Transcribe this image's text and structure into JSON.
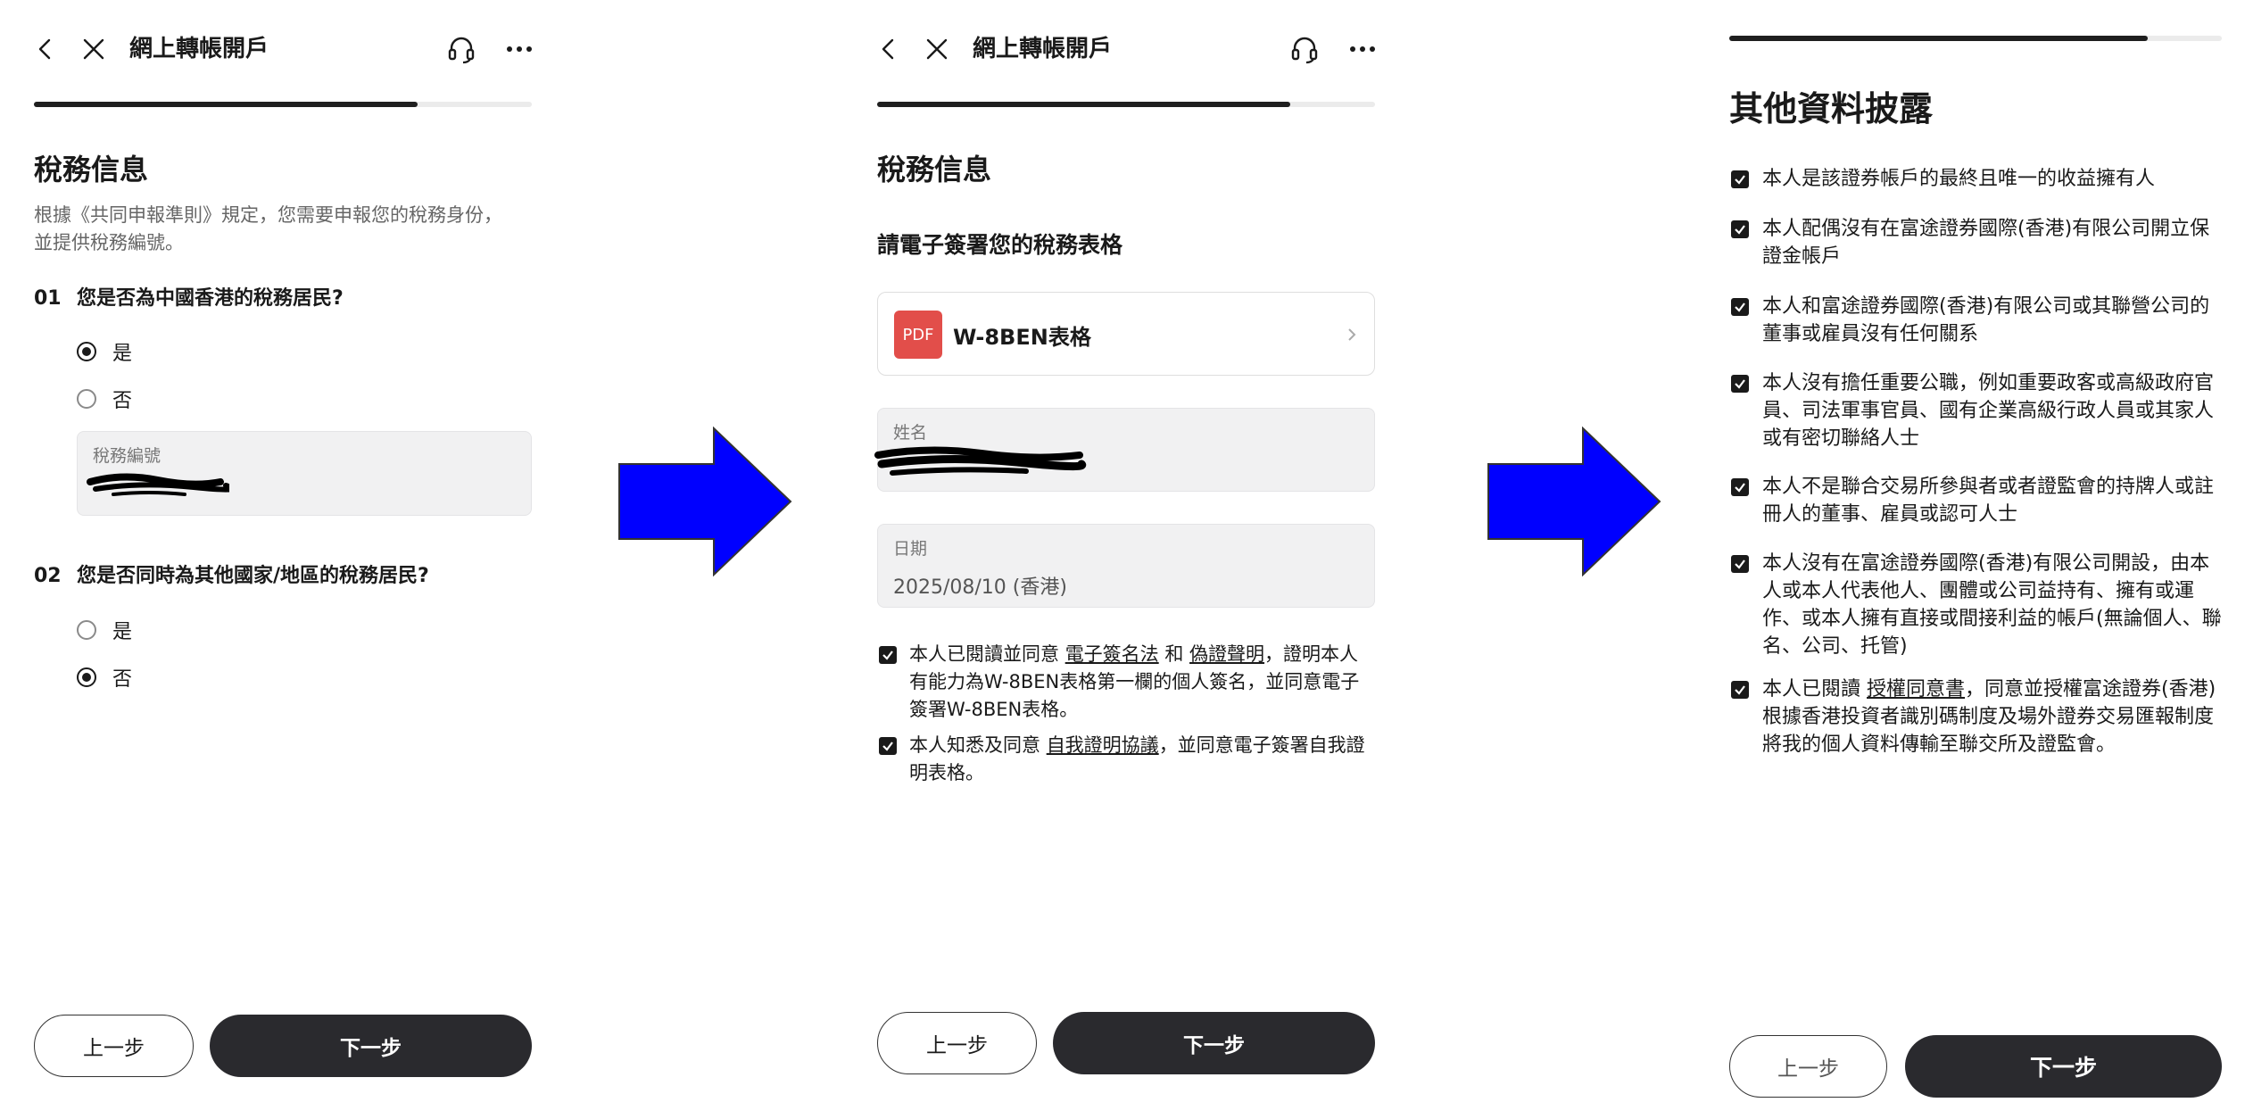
{
  "nav": {
    "title": "網上轉帳開戶"
  },
  "colors": {
    "accent": "#2a2a2e",
    "pdf_badge": "#e24e4a",
    "arrow": "#0000ff"
  },
  "screen1": {
    "progress": 0.77,
    "heading": "稅務信息",
    "description": "根據《共同申報準則》規定，您需要申報您的稅務身份，並提供稅務編號。",
    "q1": {
      "num": "01",
      "text": "您是否為中國香港的稅務居民?"
    },
    "q1_options": [
      {
        "label": "是",
        "selected": true
      },
      {
        "label": "否",
        "selected": false
      }
    ],
    "tax_field_label": "稅務編號",
    "q2": {
      "num": "02",
      "text": "您是否同時為其他國家/地區的稅務居民?"
    },
    "q2_options": [
      {
        "label": "是",
        "selected": false
      },
      {
        "label": "否",
        "selected": true
      }
    ],
    "prev_label": "上一步",
    "next_label": "下一步"
  },
  "screen2": {
    "progress": 0.83,
    "heading": "稅務信息",
    "subheading": "請電子簽署您的稅務表格",
    "pdf_badge": "PDF",
    "pdf_name": "W-8BEN表格",
    "name_label": "姓名",
    "date_label": "日期",
    "date_value": "2025/08/10 (香港)",
    "agree1": {
      "pre": "本人已閱讀並同意 ",
      "link1": "電子簽名法",
      "mid": " 和 ",
      "link2": "偽證聲明",
      "post": "，證明本人有能力為W-8BEN表格第一欄的個人簽名，並同意電子簽署W-8BEN表格。"
    },
    "agree2": {
      "pre": "本人知悉及同意 ",
      "link": "自我證明協議",
      "post": "，並同意電子簽署自我證明表格。"
    },
    "prev_label": "上一步",
    "next_label": "下一步"
  },
  "screen3": {
    "progress": 0.85,
    "heading": "其他資料披露",
    "items": [
      "本人是該證券帳戶的最終且唯一的收益擁有人",
      "本人配偶沒有在富途證券國際(香港)有限公司開立保證金帳戶",
      "本人和富途證券國際(香港)有限公司或其聯營公司的董事或雇員沒有任何關系",
      "本人沒有擔任重要公職，例如重要政客或高級政府官員、司法軍事官員、國有企業高級行政人員或其家人或有密切聯絡人士",
      "本人不是聯合交易所參與者或者證監會的持牌人或註冊人的董事、雇員或認可人士",
      "本人沒有在富途證券國際(香港)有限公司開設，由本人或本人代表他人、團體或公司益持有、擁有或運作、或本人擁有直接或間接利益的帳戶(無論個人、聯名、公司、托管)"
    ],
    "last_item": {
      "pre": "本人已閱讀 ",
      "link": "授權同意書",
      "post": "，同意並授權富途證券(香港)根據香港投資者識別碼制度及場外證券交易匯報制度將我的個人資料傳輸至聯交所及證監會。"
    },
    "prev_label": "上一步",
    "next_label": "下一步"
  }
}
